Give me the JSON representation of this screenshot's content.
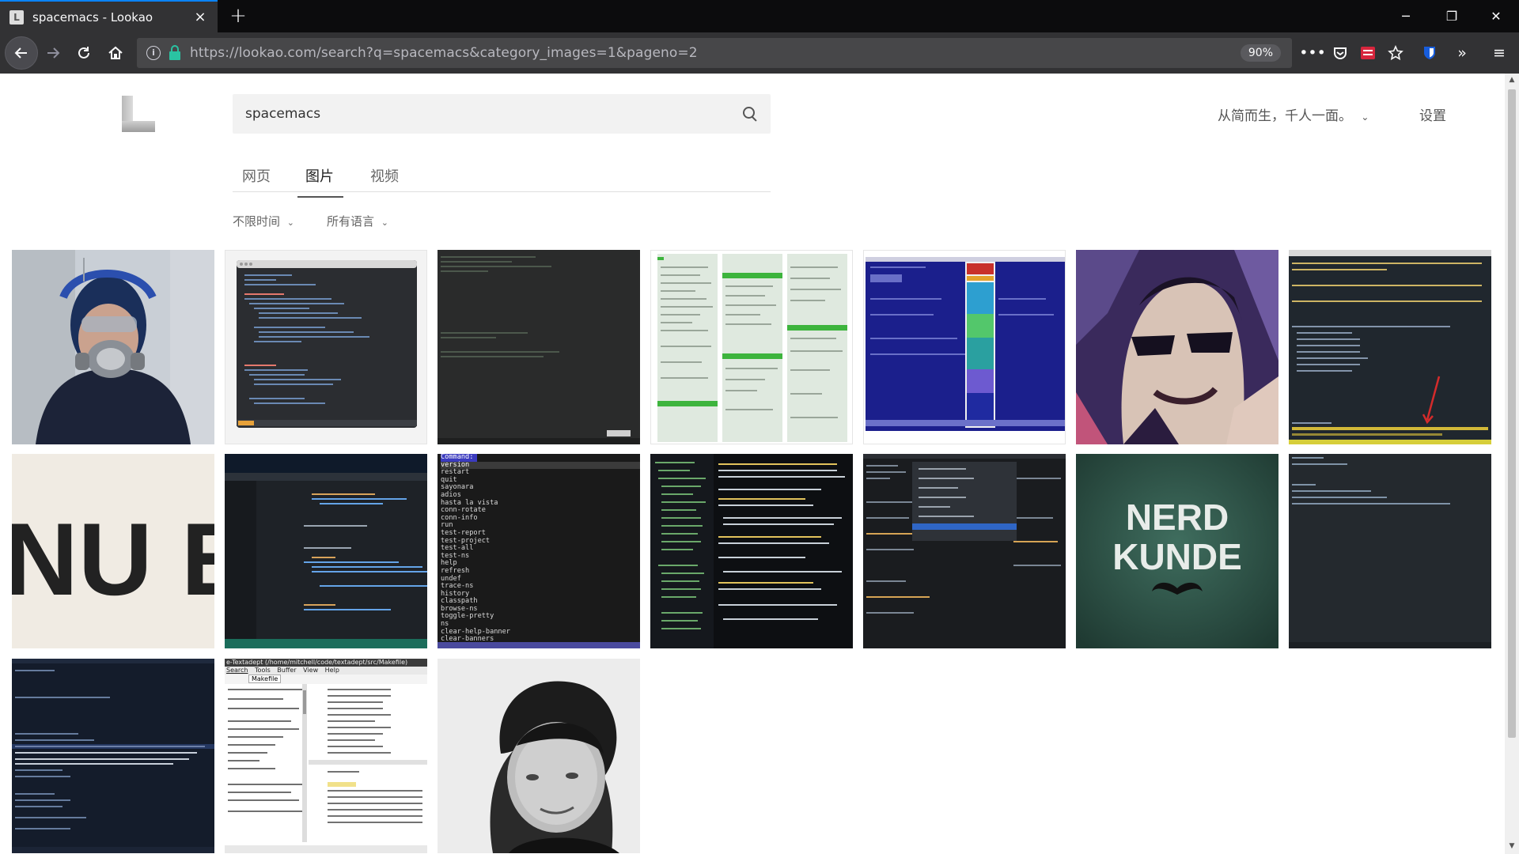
{
  "browser": {
    "tab_title": "spacemacs - Lookao",
    "url": "https://lookao.com/search?q=spacemacs&category_images=1&pageno=2",
    "zoom": "90%",
    "close_tab": "×",
    "new_tab": "+",
    "minimize": "─",
    "restore": "❐",
    "close_window": "✕"
  },
  "header": {
    "search_query": "spacemacs",
    "slogan": "从简而生，千人一面。",
    "settings": "设置"
  },
  "tabs": [
    {
      "label": "网页"
    },
    {
      "label": "图片"
    },
    {
      "label": "视频"
    }
  ],
  "filters": {
    "time": "不限时间",
    "language": "所有语言"
  },
  "results_colors": {
    "accent": "#0a84ff",
    "lock_green": "#2ac3a2"
  },
  "thumb_texts": {
    "nerd": "NERD",
    "kunde": "KUNDE",
    "nue": "NU E",
    "command": "Command:",
    "menu_items": [
      "version",
      "restart",
      "quit",
      "sayonara",
      "adios",
      "hasta la vista",
      "conn-rotate",
      "conn-info",
      "run",
      "test-report",
      "test-project",
      "test-all",
      "test-ns",
      "help",
      "refresh",
      "undef",
      "trace-ns",
      "history",
      "classpath",
      "browse-ns",
      "toggle-pretty",
      "ns",
      "clear-help-banner",
      "clear-banners"
    ],
    "textadept_title": "e-Textadept (/home/mitchell/code/textadept/src/Makefile)",
    "textadept_menu": [
      "Search",
      "Tools",
      "Buffer",
      "View",
      "Help"
    ],
    "textadept_tab": "Makefile"
  }
}
